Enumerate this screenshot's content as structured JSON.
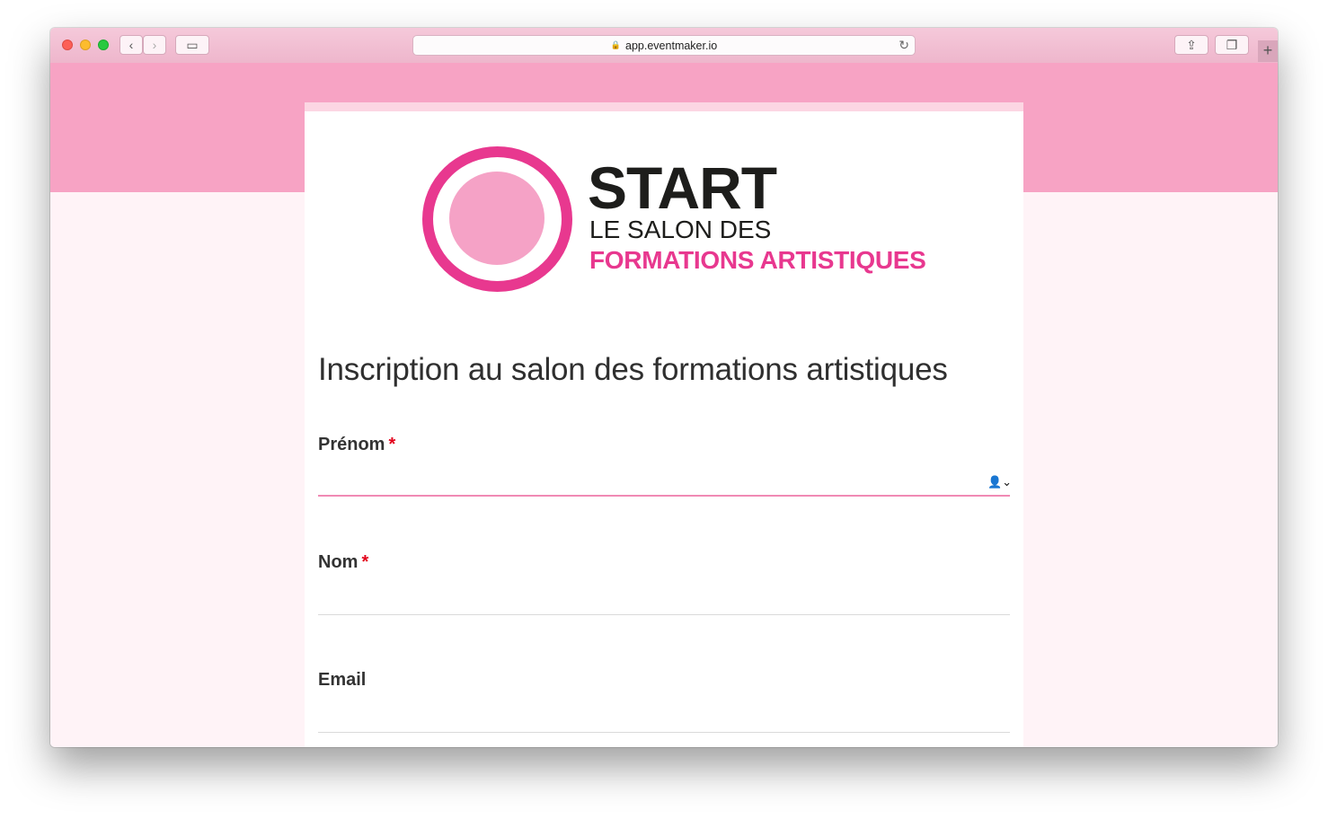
{
  "browser": {
    "url": "app.eventmaker.io",
    "back_icon": "‹",
    "forward_icon": "›",
    "sidebar_icon": "▭",
    "share_icon": "⇪",
    "tabs_icon": "❐",
    "reload_icon": "↻",
    "lock_icon": "🔒",
    "new_tab_icon": "+"
  },
  "logo": {
    "title": "START",
    "line2": "LE SALON DES",
    "line3": "FORMATIONS ARTISTIQUES",
    "colors": {
      "brand_pink": "#e8388f",
      "light_pink": "#f5a2c6",
      "dark": "#1d1d1b"
    }
  },
  "form": {
    "title": "Inscription au salon des formations artistiques",
    "fields": [
      {
        "label": "Prénom",
        "required_mark": "*",
        "value": "",
        "autofill_icon": "👤⌄"
      },
      {
        "label": "Nom",
        "required_mark": "*",
        "value": ""
      },
      {
        "label": "Email",
        "required_mark": "",
        "value": ""
      }
    ]
  },
  "theme": {
    "banner": "#f7a3c4",
    "page_bg": "#fff3f7",
    "required_color": "#e3001b"
  }
}
